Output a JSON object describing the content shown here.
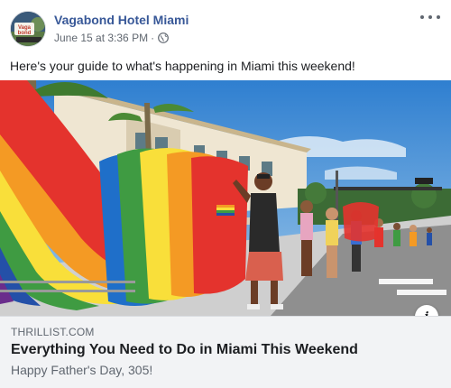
{
  "post": {
    "page_name": "Vagabond Hotel Miami",
    "timestamp": "June 15 at 3:36 PM",
    "separator": "·",
    "privacy_icon": "globe-icon",
    "more_icon": "more-options-icon",
    "caption": "Here's your guide to what's happening in Miami this weekend!"
  },
  "link_preview": {
    "domain": "THRILLIST.COM",
    "title": "Everything You Need to Do in Miami This Weekend",
    "description": "Happy Father's Day, 305!",
    "info_label": "i"
  },
  "avatar": {
    "logo_text_1": "Vaga",
    "logo_text_2": "bond"
  },
  "colors": {
    "page_name": "#385898",
    "meta_text": "#606770",
    "link_box_bg": "#f2f3f5"
  }
}
